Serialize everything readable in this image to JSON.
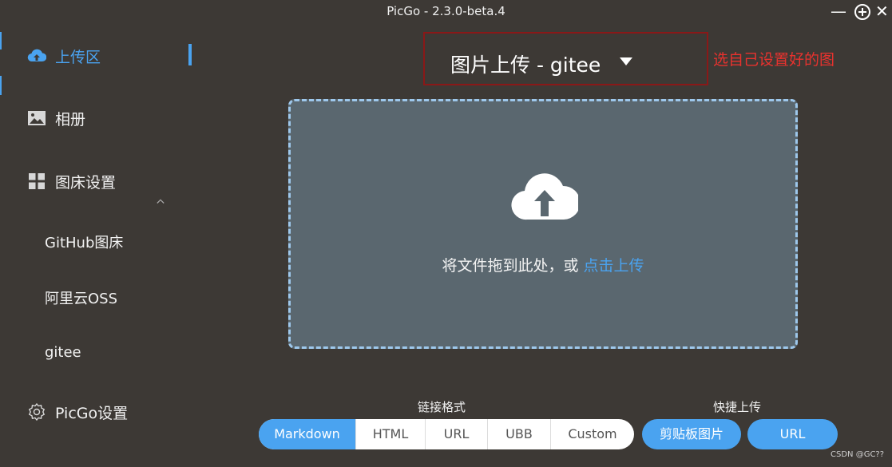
{
  "window": {
    "title": "PicGo - 2.3.0-beta.4",
    "min_icon": "minimize-icon",
    "max_icon": "maximize-icon",
    "close_icon": "close-icon"
  },
  "sidebar": {
    "items": [
      {
        "label": "上传区",
        "icon": "cloud-upload-icon",
        "active": true
      },
      {
        "label": "相册",
        "icon": "image-icon"
      },
      {
        "label": "图床设置",
        "icon": "grid-icon",
        "expanded": true
      },
      {
        "label": "PicGo设置",
        "icon": "gear-icon"
      }
    ],
    "sub_items": [
      "GitHub图床",
      "阿里云OSS",
      "gitee"
    ]
  },
  "uploader": {
    "picker_label": "图片上传 - gitee",
    "annotation": "选自己设置好的图",
    "drop_text": "将文件拖到此处，或 ",
    "drop_link": "点击上传"
  },
  "link_format": {
    "title": "链接格式",
    "options": [
      "Markdown",
      "HTML",
      "URL",
      "UBB",
      "Custom"
    ],
    "selected": "Markdown"
  },
  "quick_upload": {
    "title": "快捷上传",
    "buttons": [
      "剪贴板图片",
      "URL"
    ]
  },
  "watermark": "CSDN @GC??",
  "colors": {
    "accent": "#4aa3f0",
    "background": "#3d3935",
    "dropzone": "#5a676f",
    "annotation": "#e8322e",
    "highlight_border": "#8a1818"
  }
}
